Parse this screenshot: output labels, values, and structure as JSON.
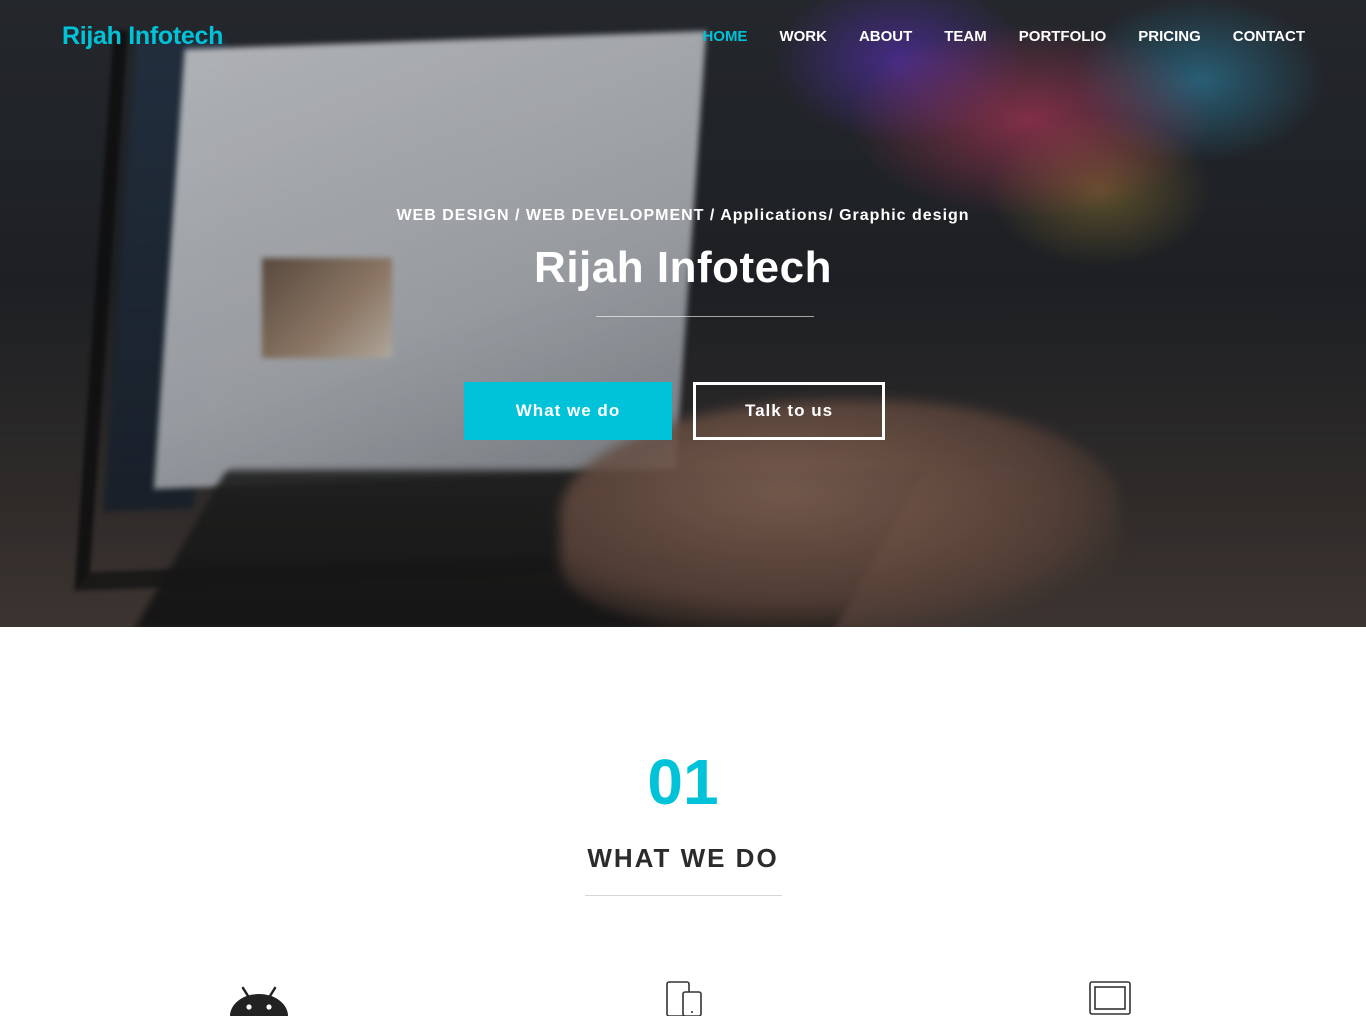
{
  "brand": {
    "name": "Rijah Infotech"
  },
  "nav": {
    "items": [
      {
        "label": "HOME",
        "active": true
      },
      {
        "label": "WORK",
        "active": false
      },
      {
        "label": "ABOUT",
        "active": false
      },
      {
        "label": "TEAM",
        "active": false
      },
      {
        "label": "PORTFOLIO",
        "active": false
      },
      {
        "label": "PRICING",
        "active": false
      },
      {
        "label": "CONTACT",
        "active": false
      }
    ]
  },
  "hero": {
    "tagline": "WEB DESIGN / WEB DEVELOPMENT / Applications/ Graphic design",
    "title": "Rijah Infotech",
    "primary_button": "What we do",
    "secondary_button": "Talk to us"
  },
  "section": {
    "number": "01",
    "title": "WHAT WE DO",
    "icons": [
      "android-icon",
      "mobile-devices-icon",
      "desktop-icon"
    ]
  },
  "colors": {
    "accent": "#00c3d9",
    "heading": "#2b2b2b",
    "white": "#ffffff"
  }
}
